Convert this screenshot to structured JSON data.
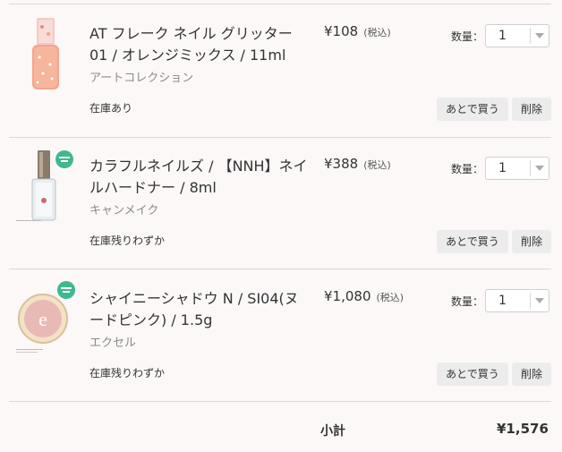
{
  "cart": {
    "items": [
      {
        "name": "AT フレーク ネイル グリッター 01 / オレンジミックス / 11ml",
        "brand": "アートコレクション",
        "price": "¥108",
        "tax": "(税込)",
        "qty_label": "数量：",
        "qty": "1",
        "stock": "在庫あり",
        "later_label": "あとで買う",
        "delete_label": "削除",
        "thumb_icon": "orange-glitter-nail-polish-bottle"
      },
      {
        "name": "カラフルネイルズ / 【NNH】ネイルハードナー / 8ml",
        "brand": "キャンメイク",
        "price": "¥388",
        "tax": "(税込)",
        "qty_label": "数量：",
        "qty": "1",
        "stock": "在庫残りわずか",
        "later_label": "あとで買う",
        "delete_label": "削除",
        "thumb_icon": "clear-nail-hardener-bottle"
      },
      {
        "name": "シャイニーシャドウ N / SI04(ヌードピンク) / 1.5g",
        "brand": "エクセル",
        "price": "¥1,080",
        "tax": "(税込)",
        "qty_label": "数量：",
        "qty": "1",
        "stock": "在庫残りわずか",
        "later_label": "あとで買う",
        "delete_label": "削除",
        "thumb_icon": "eyeshadow-compact"
      }
    ],
    "subtotal_label": "小計",
    "subtotal_value": "¥1,576"
  },
  "colors": {
    "background": "#fcf8f8",
    "badge_green": "#3fb88f",
    "button_bg": "#ececec"
  }
}
